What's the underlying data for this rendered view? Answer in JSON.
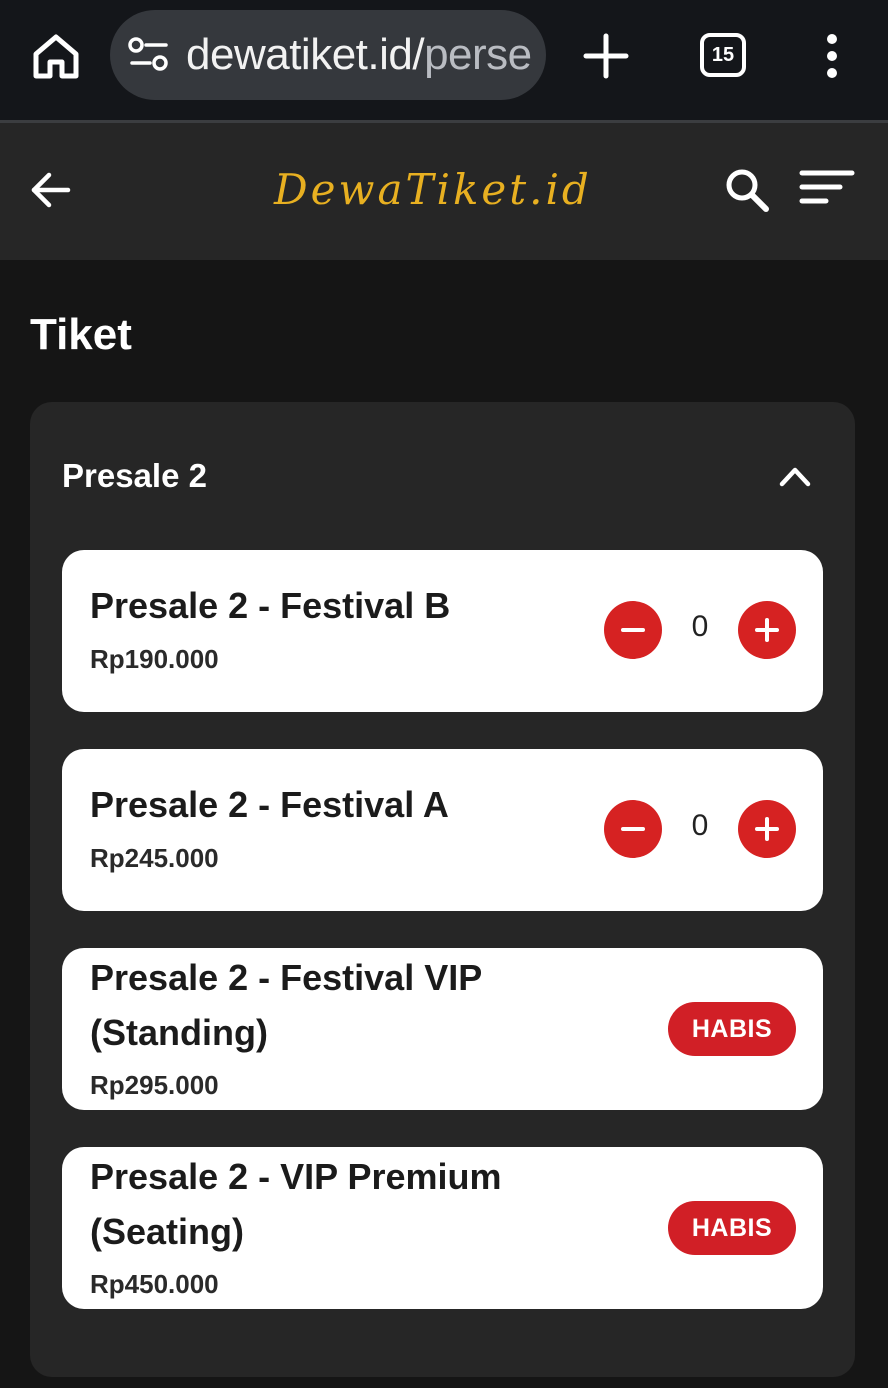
{
  "browser": {
    "url_main": "dewatiket.id/",
    "url_rest": "perse",
    "tab_count": "15"
  },
  "header": {
    "logo_text": "DewaTiket.id"
  },
  "page": {
    "title": "Tiket"
  },
  "group": {
    "title": "Presale 2",
    "tickets": [
      {
        "name": "Presale 2 - Festival B",
        "price": "Rp190.000",
        "quantity": "0",
        "status": "available"
      },
      {
        "name": "Presale 2 - Festival A",
        "price": "Rp245.000",
        "quantity": "0",
        "status": "available"
      },
      {
        "name": "Presale 2 - Festival VIP (Standing)",
        "price": "Rp295.000",
        "status": "HABIS"
      },
      {
        "name": "Presale 2 - VIP Premium (Seating)",
        "price": "Rp450.000",
        "status": "HABIS"
      }
    ]
  },
  "colors": {
    "accent_red": "#d62222",
    "logo_gold": "#e8b021",
    "background": "#151515",
    "card": "#262626"
  }
}
